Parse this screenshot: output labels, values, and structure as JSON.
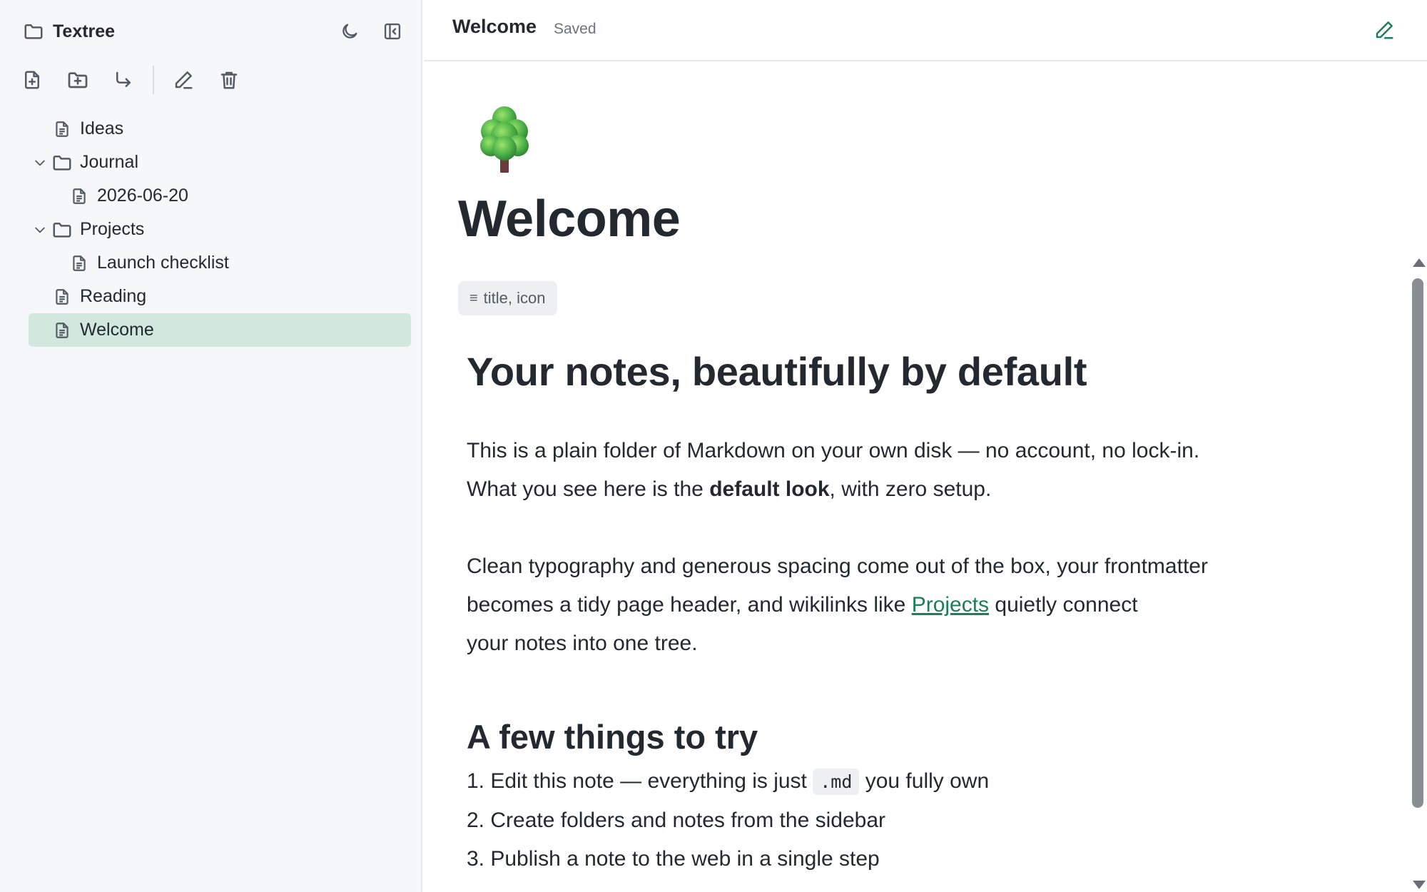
{
  "sidebar": {
    "app_name": "Textree",
    "tree": [
      {
        "label": "Ideas",
        "type": "file",
        "depth": 0,
        "expanded": null,
        "active": false
      },
      {
        "label": "Journal",
        "type": "folder",
        "depth": 0,
        "expanded": true,
        "active": false
      },
      {
        "label": "2026-06-20",
        "type": "file",
        "depth": 1,
        "expanded": null,
        "active": false
      },
      {
        "label": "Projects",
        "type": "folder",
        "depth": 0,
        "expanded": true,
        "active": false
      },
      {
        "label": "Launch checklist",
        "type": "file",
        "depth": 1,
        "expanded": null,
        "active": false
      },
      {
        "label": "Reading",
        "type": "file",
        "depth": 0,
        "expanded": null,
        "active": false
      },
      {
        "label": "Welcome",
        "type": "file",
        "depth": 0,
        "expanded": null,
        "active": true
      }
    ]
  },
  "topbar": {
    "title": "Welcome",
    "status": "Saved"
  },
  "doc": {
    "emoji": "tree",
    "title": "Welcome",
    "frontmatter_chip": {
      "glyph": "≡",
      "text": "title, icon"
    },
    "h2": "Your notes, beautifully by default",
    "p1": {
      "a": "This is a plain folder of Markdown on your own disk — no account, no lock-in.",
      "b": "What you see here is the ",
      "bold": "default look",
      "c": ", with zero setup."
    },
    "p2": {
      "a": "Clean typography and generous spacing come out of the box, your frontmatter",
      "b": "becomes a tidy page header, and wikilinks like ",
      "link": "Projects",
      "c": " quietly connect",
      "d": "your notes into one tree."
    },
    "h3": "A few things to try",
    "list": {
      "item1_a": "1. Edit this note — everything is just ",
      "item1_code": ".md",
      "item1_b": " you fully own",
      "item2": "2. Create folders and notes from the sidebar",
      "item3": "3. Publish a note to the web in a single step"
    }
  },
  "colors": {
    "accent": "#1a7f5a",
    "active_row": "#d2e8df",
    "sidebar_bg": "#f6f7f9"
  }
}
